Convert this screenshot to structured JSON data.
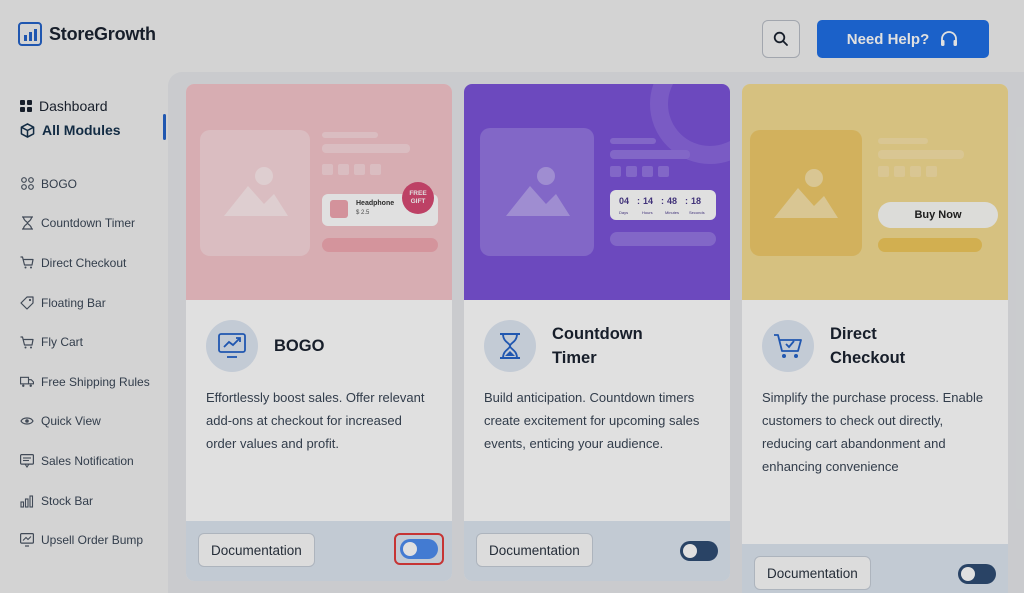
{
  "app": {
    "name": "StoreGrowth"
  },
  "header": {
    "help_label": "Need Help?"
  },
  "sidebar": {
    "top": [
      {
        "label": "Dashboard",
        "icon": "dashboard-icon"
      },
      {
        "label": "All Modules",
        "icon": "cube-icon"
      }
    ],
    "modules": [
      {
        "label": "BOGO",
        "icon": "bogo-icon"
      },
      {
        "label": "Countdown Timer",
        "icon": "hourglass-icon"
      },
      {
        "label": "Direct Checkout",
        "icon": "cart-icon"
      },
      {
        "label": "Floating Bar",
        "icon": "tag-icon"
      },
      {
        "label": "Fly Cart",
        "icon": "cart-icon"
      },
      {
        "label": "Free Shipping Rules",
        "icon": "truck-icon"
      },
      {
        "label": "Quick View",
        "icon": "eye-icon"
      },
      {
        "label": "Sales Notification",
        "icon": "notification-icon"
      },
      {
        "label": "Stock Bar",
        "icon": "chart-icon"
      },
      {
        "label": "Upsell Order Bump",
        "icon": "monitor-icon"
      }
    ]
  },
  "cards": [
    {
      "title_line1": "BOGO",
      "title_line2": "",
      "description": "Effortlessly boost sales. Offer relevant add-ons at checkout for increased order values and profit.",
      "hero_product_name": "Headphone",
      "hero_product_price": "$ 2.5",
      "hero_badge": "FREE GIFT",
      "doc_label": "Documentation",
      "enabled": false
    },
    {
      "title_line1": "Countdown",
      "title_line2": "Timer",
      "description": "Build anticipation. Countdown timers create excitement for upcoming sales events, enticing your audience.",
      "timer": {
        "days": "04",
        "hours": "14",
        "minutes": "48",
        "seconds": "18",
        "days_label": "Days",
        "hours_label": "Hours",
        "minutes_label": "Minutes",
        "seconds_label": "Seconds"
      },
      "doc_label": "Documentation",
      "enabled": true
    },
    {
      "title_line1": "Direct",
      "title_line2": "Checkout",
      "description": "Simplify the purchase process. Enable customers to check out directly, reducing cart abandonment and enhancing convenience",
      "hero_button": "Buy Now",
      "doc_label": "Documentation",
      "enabled": true
    }
  ],
  "colors": {
    "accent": "#1f6fe5",
    "bogo_hero": "#f5c5cb",
    "countdown_hero": "#7b54d9",
    "checkout_hero": "#f4dc92"
  }
}
